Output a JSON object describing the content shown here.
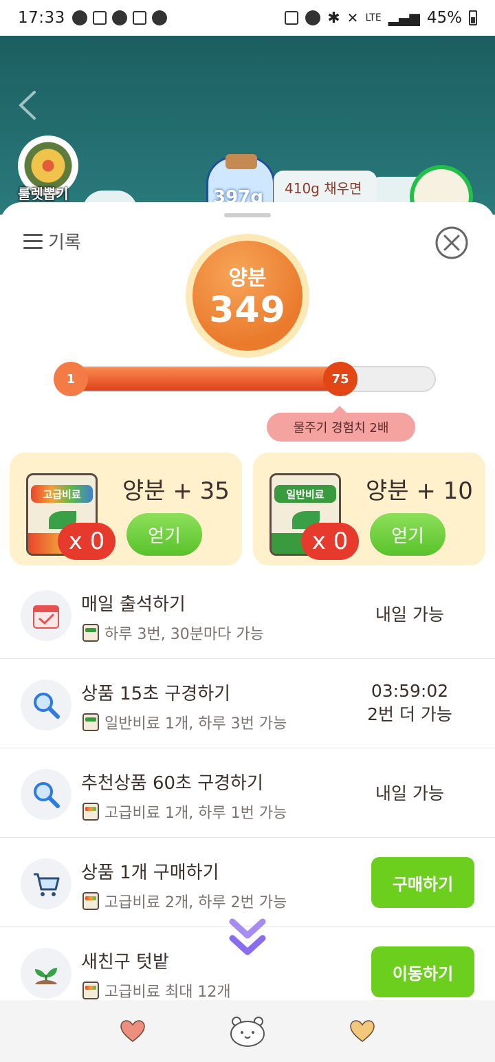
{
  "status_bar": {
    "time": "17:33",
    "battery": "45%",
    "network": "LTE"
  },
  "game": {
    "roulette_label": "룰렛뽑기",
    "jar_label": "397g",
    "bubble_text": "410g 채우면"
  },
  "sheet": {
    "record_label": "기록",
    "nutrient": {
      "label": "양분",
      "value": "349"
    },
    "progress": {
      "start": "1",
      "current": "75",
      "fill_fraction": 0.78
    },
    "tip": "물주기 경험치 2배",
    "fertilizers": [
      {
        "bag_label": "고급비료",
        "title": "양분 + 35",
        "count": "x 0",
        "button": "얻기"
      },
      {
        "bag_label": "일반비료",
        "title": "양분 + 10",
        "count": "x 0",
        "button": "얻기"
      }
    ],
    "tasks": [
      {
        "title": "매일 출석하기",
        "sub": "하루 3번, 30분마다 가능",
        "status": "내일 가능"
      },
      {
        "title": "상품 15초 구경하기",
        "sub": "일반비료 1개, 하루 3번 가능",
        "status_line1": "03:59:02",
        "status_line2": "2번 더 가능"
      },
      {
        "title": "추천상품 60초 구경하기",
        "sub": "고급비료 1개, 하루 1번 가능",
        "status": "내일 가능"
      },
      {
        "title": "상품 1개 구매하기",
        "sub": "고급비료 2개, 하루 2번 가능",
        "action": "구매하기"
      },
      {
        "title": "새친구 텃밭",
        "sub": "고급비료 최대 12개",
        "action": "이동하기"
      }
    ]
  },
  "colors": {
    "accent_orange": "#ea7a2c",
    "action_green": "#6ccf1e",
    "card_bg": "#fff1cc"
  }
}
